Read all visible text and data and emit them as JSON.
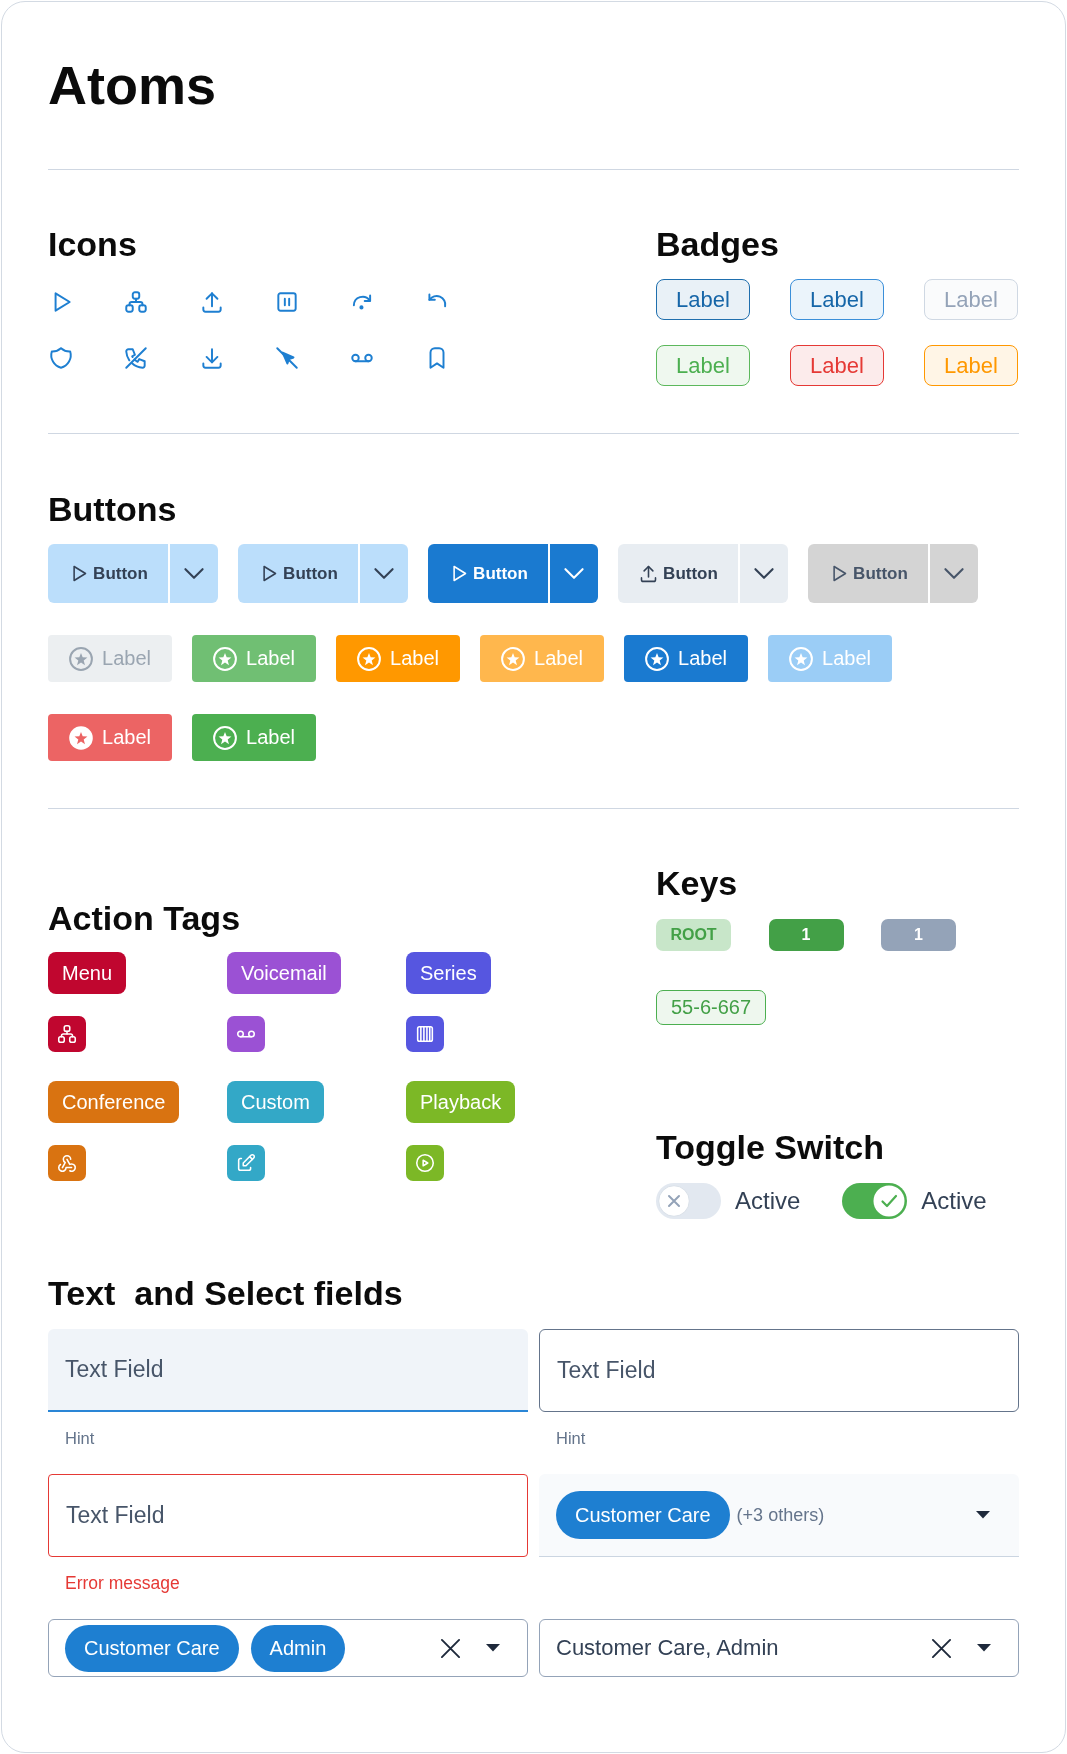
{
  "title": "Atoms",
  "icons": {
    "heading": "Icons"
  },
  "badges": {
    "heading": "Badges",
    "items": [
      {
        "label": "Label",
        "color": "#1666a8",
        "border": {
          "color": "#1f6fae"
        }
      },
      {
        "label": "Label",
        "color": "#1666a8",
        "border": {
          "color": "#3b8fd9"
        }
      },
      {
        "label": "Label",
        "color": "#94a3b8",
        "border": {
          "color": "#cfd8e3"
        }
      },
      {
        "label": "Label",
        "color": "#4caf50",
        "border": {
          "color": "#5cb85c"
        }
      },
      {
        "label": "Label",
        "color": "#e53935",
        "border": {
          "color": "#e53935"
        }
      },
      {
        "label": "Label",
        "color": "#ff9800",
        "border": {
          "color": "#ff9800"
        }
      }
    ]
  },
  "buttons": {
    "heading": "Buttons",
    "split_buttons": [
      {
        "label": "Button",
        "kind": "light"
      },
      {
        "label": "Button",
        "kind": "light"
      },
      {
        "label": "Button",
        "kind": "primary"
      },
      {
        "label": "Button",
        "kind": "pale"
      },
      {
        "label": "Button",
        "kind": "grey"
      }
    ],
    "label_buttons": [
      {
        "label": "Label",
        "color": "#eceff1",
        "disabled": true,
        "kind": "ring"
      },
      {
        "label": "Label",
        "color": "#70bf73",
        "disabled": false,
        "kind": "ring"
      },
      {
        "label": "Label",
        "color": "#ff9800",
        "disabled": false,
        "kind": "ring"
      },
      {
        "label": "Label",
        "color": "#ffb74d",
        "disabled": false,
        "kind": "ring"
      },
      {
        "label": "Label",
        "color": "#1a7ad0",
        "disabled": false,
        "kind": "ring"
      },
      {
        "label": "Label",
        "color": "#9bcdf6",
        "disabled": false,
        "kind": "ring"
      },
      {
        "label": "Label",
        "color": "#ec6464",
        "disabled": false,
        "kind": "disc"
      },
      {
        "label": "Label",
        "color": "#4caf50",
        "disabled": false,
        "kind": "ring"
      }
    ]
  },
  "action_tags": {
    "heading": "Action Tags",
    "items": [
      {
        "label": "Menu",
        "color": "#c0062f"
      },
      {
        "label": "Voicemail",
        "color": "#9b51d4"
      },
      {
        "label": "Series",
        "color": "#5656e0"
      },
      {
        "label": "Conference",
        "color": "#d97311"
      },
      {
        "label": "Custom",
        "color": "#33a8c7"
      },
      {
        "label": "Playback",
        "color": "#7cb826"
      }
    ]
  },
  "keys": {
    "heading": "Keys",
    "items": [
      {
        "label": "ROOT",
        "kind": "soft"
      },
      {
        "label": "1",
        "kind": "solid"
      },
      {
        "label": "1",
        "kind": "muted"
      },
      {
        "label": "55-6-667",
        "kind": "outline"
      }
    ]
  },
  "toggle_switch": {
    "heading": "Toggle Switch",
    "items": [
      {
        "label": "Active",
        "on": false
      },
      {
        "label": "Active",
        "on": true
      }
    ]
  },
  "fields": {
    "heading": "Text  and Select fields",
    "items": [
      {
        "kind": "filled",
        "placeholder": "Text Field",
        "hint": "Hint"
      },
      {
        "kind": "outlined",
        "placeholder": "Text Field",
        "hint": "Hint"
      },
      {
        "kind": "invalid",
        "placeholder": "Text Field",
        "error": "Error message"
      },
      {
        "kind": "summary",
        "chips": [
          "Customer Care"
        ],
        "more": "(+3 others)"
      },
      {
        "kind": "chips",
        "chips": [
          "Customer Care",
          "Admin"
        ]
      },
      {
        "kind": "plain",
        "value": "Customer Care, Admin"
      }
    ]
  }
}
